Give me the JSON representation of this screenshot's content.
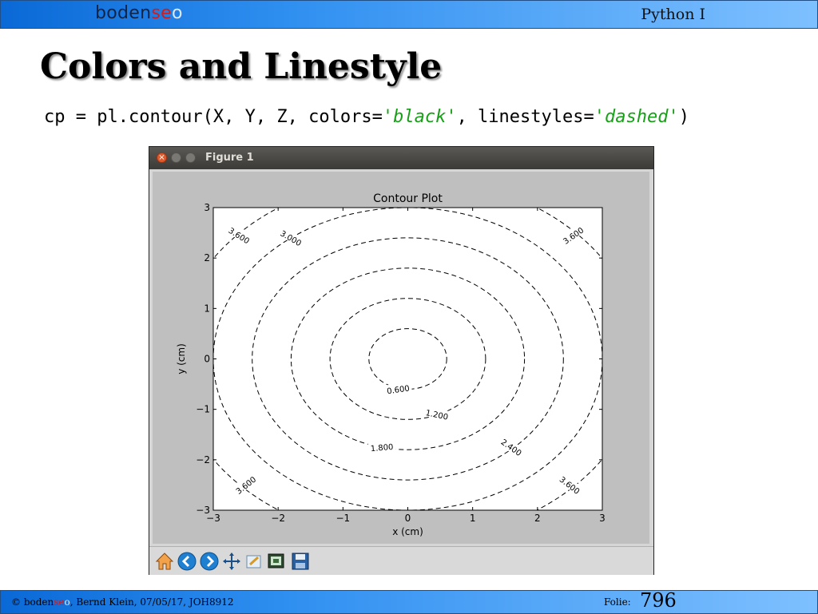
{
  "header": {
    "brand": {
      "part1": "boden",
      "part2": "se",
      "part3": "o"
    },
    "course": "Python I"
  },
  "slide": {
    "title": "Colors and Linestyle",
    "code": {
      "prefix": "cp = pl.contour(X, Y, Z, colors=",
      "colors_arg": "'black'",
      "middle": ", linestyles=",
      "linestyles_arg": "'dashed'",
      "suffix": ")"
    }
  },
  "window": {
    "title": "Figure 1",
    "close_glyph": "×",
    "toolbar_icons": [
      "home-icon",
      "back-icon",
      "forward-icon",
      "pan-icon",
      "configure-icon",
      "zoom-icon",
      "save-icon"
    ]
  },
  "chart_data": {
    "type": "contour",
    "title": "Contour Plot",
    "xlabel": "x (cm)",
    "ylabel": "y (cm)",
    "xlim": [
      -3,
      3
    ],
    "ylim": [
      -3,
      3
    ],
    "x_ticks": [
      -3,
      -2,
      -1,
      0,
      1,
      2,
      3
    ],
    "y_ticks": [
      -3,
      -2,
      -1,
      0,
      1,
      2,
      3
    ],
    "x_tick_labels": [
      "−3",
      "−2",
      "−1",
      "0",
      "1",
      "2",
      "3"
    ],
    "y_tick_labels": [
      "−3",
      "−2",
      "−1",
      "0",
      "1",
      "2",
      "3"
    ],
    "line_color": "#000000",
    "linestyle": "dashed",
    "levels": [
      0.6,
      1.2,
      1.8,
      2.4,
      3.0,
      3.6
    ],
    "level_labels": [
      {
        "text": "0.600",
        "x": -0.15,
        "y": -0.6,
        "angle": 8
      },
      {
        "text": "1.200",
        "x": 0.45,
        "y": -1.1,
        "angle": -12
      },
      {
        "text": "1.800",
        "x": -0.4,
        "y": -1.75,
        "angle": 5
      },
      {
        "text": "2.400",
        "x": 1.6,
        "y": -1.75,
        "angle": -35
      },
      {
        "text": "3.000",
        "x": -1.8,
        "y": 2.4,
        "angle": -30
      },
      {
        "text": "3.600",
        "x": -2.6,
        "y": 2.45,
        "angle": -32
      },
      {
        "text": "3.600",
        "x": 2.55,
        "y": 2.45,
        "angle": 35
      },
      {
        "text": "3.600",
        "x": -2.5,
        "y": -2.5,
        "angle": 38
      },
      {
        "text": "3.600",
        "x": 2.5,
        "y": -2.5,
        "angle": -38
      }
    ],
    "background": "#bfbfbf",
    "axes_facecolor": "#ffffff"
  },
  "footer": {
    "copyright_prefix": "© ",
    "brand": {
      "part1": "boden",
      "part2": "se",
      "part3": "o"
    },
    "copyright_suffix": ", Bernd Klein, 07/05/17, JOH8912",
    "folie_label": "Folie:",
    "slide_number": "796"
  }
}
